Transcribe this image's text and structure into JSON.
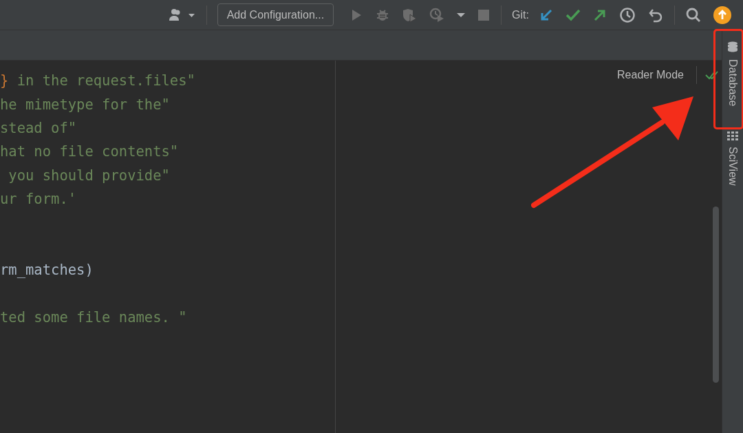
{
  "toolbar": {
    "items": [
      {
        "kind": "user",
        "disabled": false
      },
      {
        "kind": "sep"
      },
      {
        "kind": "config",
        "label": "Add Configuration..."
      },
      {
        "kind": "run",
        "disabled": true
      },
      {
        "kind": "debug",
        "disabled": true
      },
      {
        "kind": "coverage",
        "disabled": true
      },
      {
        "kind": "profile",
        "disabled": true
      },
      {
        "kind": "caret",
        "disabled": false
      },
      {
        "kind": "stop",
        "disabled": true
      },
      {
        "kind": "sep"
      },
      {
        "kind": "label",
        "label": "Git:"
      },
      {
        "kind": "update",
        "disabled": false
      },
      {
        "kind": "commit",
        "disabled": false
      },
      {
        "kind": "push",
        "disabled": false
      },
      {
        "kind": "history",
        "disabled": false
      },
      {
        "kind": "rollback",
        "disabled": false
      },
      {
        "kind": "sep"
      },
      {
        "kind": "search",
        "disabled": false
      },
      {
        "kind": "upgrade",
        "disabled": false
      }
    ]
  },
  "editor": {
    "lines": [
      {
        "kind": "code",
        "tokens": [
          {
            "kind": "brace",
            "text": "}"
          },
          {
            "kind": "string",
            "text": " in the request.files\""
          }
        ]
      },
      {
        "kind": "code",
        "tokens": [
          {
            "kind": "string",
            "text": "he mimetype for the\""
          }
        ]
      },
      {
        "kind": "code",
        "tokens": [
          {
            "kind": "string",
            "text": "stead of\""
          }
        ]
      },
      {
        "kind": "code",
        "tokens": [
          {
            "kind": "string",
            "text": "hat no file contents\""
          }
        ]
      },
      {
        "kind": "code",
        "tokens": [
          {
            "kind": "string",
            "text": " you should provide\""
          }
        ]
      },
      {
        "kind": "code",
        "tokens": [
          {
            "kind": "string",
            "text": "ur form.'"
          }
        ]
      },
      {
        "kind": "blank"
      },
      {
        "kind": "blank"
      },
      {
        "kind": "code",
        "tokens": [
          {
            "kind": "plain",
            "text": "rm_matches)"
          }
        ]
      },
      {
        "kind": "blank"
      },
      {
        "kind": "code",
        "tokens": [
          {
            "kind": "string",
            "text": "ted some file names. \""
          }
        ]
      }
    ]
  },
  "preview": {
    "reader_mode": "Reader Mode"
  },
  "right_sidebar": {
    "tabs": [
      {
        "label": "Database",
        "kind": "database",
        "selected": false
      },
      {
        "label": "SciView",
        "kind": "sciview",
        "selected": false
      }
    ]
  },
  "annotations": {
    "highlight_frame": true,
    "arrow": true
  }
}
